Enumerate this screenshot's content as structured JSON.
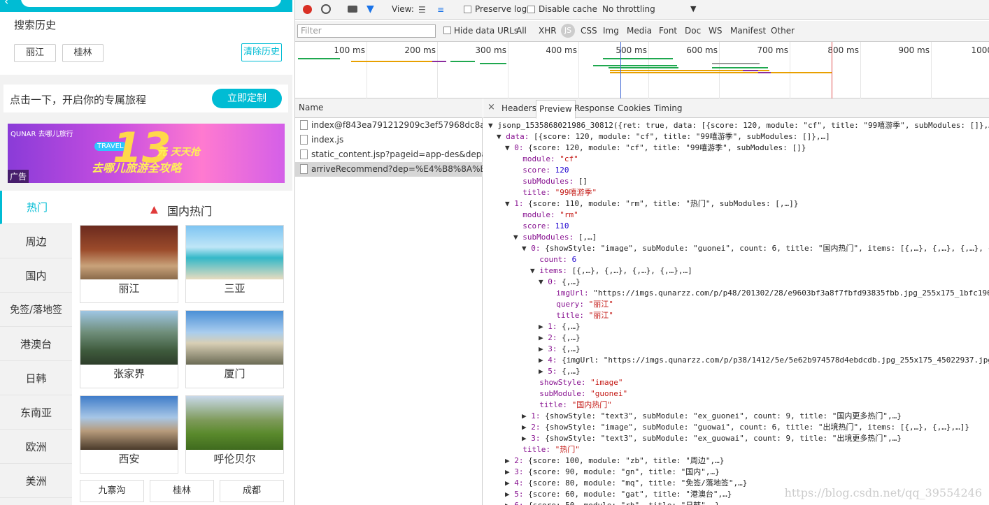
{
  "app": {
    "search_placeholder": "",
    "history_title": "搜索历史",
    "history_tags": [
      "丽江",
      "桂林"
    ],
    "clear_label": "清除历史",
    "custom_text": "点击一下，开启你的专属旅程",
    "custom_btn": "立即定制",
    "banner": {
      "ad": "广告",
      "logo": "QUNAR 去哪儿旅行",
      "travel": "TRAVEL",
      "number": "13",
      "slogan": "去哪儿旅游全攻略",
      "slogan2": "元 天天抢"
    },
    "sidebar": [
      "热门",
      "周边",
      "国内",
      "免签/落地签",
      "港澳台",
      "日韩",
      "东南亚",
      "欧洲",
      "美洲"
    ],
    "section_title": "国内热门",
    "cards": [
      "丽江",
      "三亚",
      "张家界",
      "厦门",
      "西安",
      "呼伦贝尔"
    ],
    "mini": [
      "九寨沟",
      "桂林",
      "成都"
    ]
  },
  "devtools": {
    "toolbar1": {
      "view": "View:",
      "preserve_log": "Preserve log",
      "disable_cache": "Disable cache",
      "throttle": "No throttling"
    },
    "toolbar2": {
      "filter_placeholder": "Filter",
      "hide_data_urls": "Hide data URLs",
      "types": [
        "All",
        "XHR",
        "JS",
        "CSS",
        "Img",
        "Media",
        "Font",
        "Doc",
        "WS",
        "Manifest",
        "Other"
      ]
    },
    "ticks": [
      "100 ms",
      "200 ms",
      "300 ms",
      "400 ms",
      "500 ms",
      "600 ms",
      "700 ms",
      "800 ms",
      "900 ms",
      "1000"
    ],
    "name_header": "Name",
    "requests": [
      "index@f843ea791212909c3ef57968dc8a319...",
      "index.js",
      "static_content.jsp?pageid=app-des&depart...",
      "arriveRecommend?dep=%E4%B8%8A%E6%..."
    ],
    "preview_tabs": [
      "Headers",
      "Preview",
      "Response",
      "Cookies",
      "Timing"
    ],
    "json_lines": [
      {
        "ind": 0,
        "tri": "▼",
        "t": "jsonp_1535868021986_30812({ret: true, data: [{score: 120, module: \"cf\", title: \"99嘻游季\", subModules: []},…"
      },
      {
        "ind": 1,
        "tri": "▼",
        "t": "data: [{score: 120, module: \"cf\", title: \"99嘻游季\", subModules: []},…]"
      },
      {
        "ind": 2,
        "tri": "▼",
        "t": "0: {score: 120, module: \"cf\", title: \"99嘻游季\", subModules: []}"
      },
      {
        "ind": 3,
        "tri": "",
        "t": "module: \"cf\""
      },
      {
        "ind": 3,
        "tri": "",
        "t": "score: 120"
      },
      {
        "ind": 3,
        "tri": "",
        "t": "subModules: []"
      },
      {
        "ind": 3,
        "tri": "",
        "t": "title: \"99嘻游季\""
      },
      {
        "ind": 2,
        "tri": "▼",
        "t": "1: {score: 110, module: \"rm\", title: \"热门\", subModules: [,…]}"
      },
      {
        "ind": 3,
        "tri": "",
        "t": "module: \"rm\""
      },
      {
        "ind": 3,
        "tri": "",
        "t": "score: 110"
      },
      {
        "ind": 3,
        "tri": "▼",
        "t": "subModules: [,…]"
      },
      {
        "ind": 4,
        "tri": "▼",
        "t": "0: {showStyle: \"image\", subModule: \"guonei\", count: 6, title: \"国内热门\", items: [{,…}, {,…}, {,…}, {"
      },
      {
        "ind": 5,
        "tri": "",
        "t": "count: 6"
      },
      {
        "ind": 5,
        "tri": "▼",
        "t": "items: [{,…}, {,…}, {,…}, {,…},…]"
      },
      {
        "ind": 6,
        "tri": "▼",
        "t": "0: {,…}"
      },
      {
        "ind": 7,
        "tri": "",
        "t": "imgUrl: \"https://imgs.qunarzz.com/p/p48/201302/28/e9603bf3a8f7fbfd93835fbb.jpg_255x175_1bfc196d"
      },
      {
        "ind": 7,
        "tri": "",
        "t": "query: \"丽江\""
      },
      {
        "ind": 7,
        "tri": "",
        "t": "title: \"丽江\""
      },
      {
        "ind": 6,
        "tri": "▶",
        "t": "1: {,…}"
      },
      {
        "ind": 6,
        "tri": "▶",
        "t": "2: {,…}"
      },
      {
        "ind": 6,
        "tri": "▶",
        "t": "3: {,…}"
      },
      {
        "ind": 6,
        "tri": "▶",
        "t": "4: {imgUrl: \"https://imgs.qunarzz.com/p/p38/1412/5e/5e62b974578d4ebdcdb.jpg_255x175_45022937.jpg\""
      },
      {
        "ind": 6,
        "tri": "▶",
        "t": "5: {,…}"
      },
      {
        "ind": 5,
        "tri": "",
        "t": "showStyle: \"image\""
      },
      {
        "ind": 5,
        "tri": "",
        "t": "subModule: \"guonei\""
      },
      {
        "ind": 5,
        "tri": "",
        "t": "title: \"国内热门\""
      },
      {
        "ind": 4,
        "tri": "▶",
        "t": "1: {showStyle: \"text3\", subModule: \"ex_guonei\", count: 9, title: \"国内更多热门\",…}"
      },
      {
        "ind": 4,
        "tri": "▶",
        "t": "2: {showStyle: \"image\", subModule: \"guowai\", count: 6, title: \"出境热门\", items: [{,…}, {,…},…]}"
      },
      {
        "ind": 4,
        "tri": "▶",
        "t": "3: {showStyle: \"text3\", subModule: \"ex_guowai\", count: 9, title: \"出境更多热门\",…}"
      },
      {
        "ind": 3,
        "tri": "",
        "t": "title: \"热门\""
      },
      {
        "ind": 2,
        "tri": "▶",
        "t": "2: {score: 100, module: \"zb\", title: \"周边\",…}"
      },
      {
        "ind": 2,
        "tri": "▶",
        "t": "3: {score: 90, module: \"gn\", title: \"国内\",…}"
      },
      {
        "ind": 2,
        "tri": "▶",
        "t": "4: {score: 80, module: \"mq\", title: \"免签/落地签\",…}"
      },
      {
        "ind": 2,
        "tri": "▶",
        "t": "5: {score: 60, module: \"gat\", title: \"港澳台\",…}"
      },
      {
        "ind": 2,
        "tri": "▶",
        "t": "6: {score: 50, module: \"rh\", title: \"日韩\",…}"
      }
    ],
    "watermark": "https://blog.csdn.net/qq_39554246"
  }
}
